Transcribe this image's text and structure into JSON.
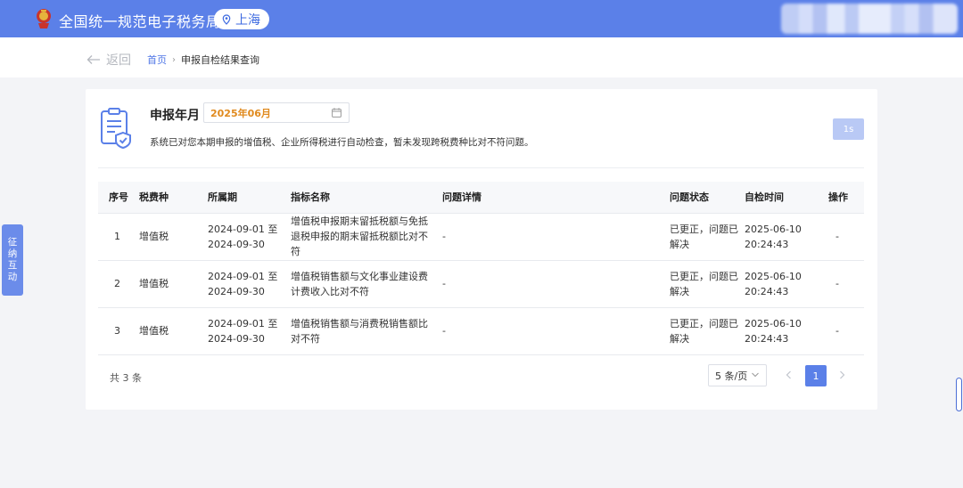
{
  "header": {
    "site_title": "全国统一规范电子税务局",
    "region": "上海",
    "colors": {
      "topbar": "#5b80e8",
      "accent": "#4f76e6",
      "period_value": "#e08a1e"
    }
  },
  "nav": {
    "back_label": "返回",
    "breadcrumb": {
      "home": "首页",
      "separator": "›",
      "current": "申报自检结果查询"
    }
  },
  "filter": {
    "period_label": "申报年月",
    "period_value": "2025年06月"
  },
  "notice": "系统已对您本期申报的增值税、企业所得税进行自动检查，暂未发现跨税费种比对不符问题。",
  "countdown_button": "1s",
  "table": {
    "headers": [
      "序号",
      "税费种",
      "所属期",
      "指标名称",
      "问题详情",
      "问题状态",
      "自检时间",
      "操作"
    ],
    "rows": [
      {
        "index": "1",
        "tax_type": "增值税",
        "period_start": "2024-09-01 至",
        "period_end": "2024-09-30",
        "indicator": "增值税申报期末留抵税额与免抵退税申报的期末留抵税额比对不符",
        "detail": "-",
        "status": "已更正，问题已解决",
        "date": "2025-06-10",
        "time": "20:24:43",
        "action": "-"
      },
      {
        "index": "2",
        "tax_type": "增值税",
        "period_start": "2024-09-01 至",
        "period_end": "2024-09-30",
        "indicator": "增值税销售额与文化事业建设费计费收入比对不符",
        "detail": "-",
        "status": "已更正，问题已解决",
        "date": "2025-06-10",
        "time": "20:24:43",
        "action": "-"
      },
      {
        "index": "3",
        "tax_type": "增值税",
        "period_start": "2024-09-01 至",
        "period_end": "2024-09-30",
        "indicator": "增值税销售额与消费税销售额比对不符",
        "detail": "-",
        "status": "已更正，问题已解决",
        "date": "2025-06-10",
        "time": "20:24:43",
        "action": "-"
      }
    ]
  },
  "pagination": {
    "total": "共 3 条",
    "page_size": "5 条/页",
    "current_page": "1"
  },
  "side_float": {
    "label_chars": [
      "征",
      "纳",
      "互",
      "动"
    ]
  }
}
